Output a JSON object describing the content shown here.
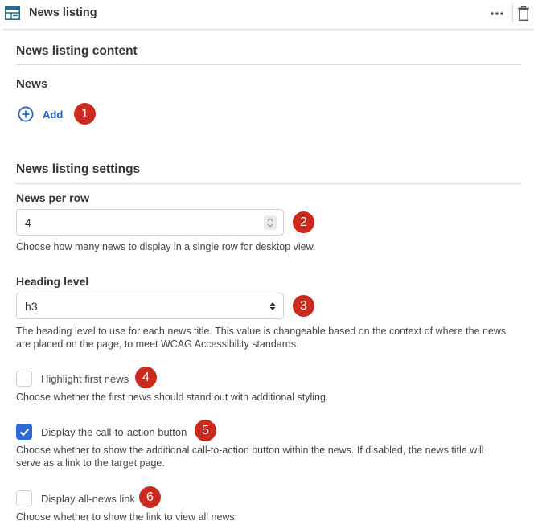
{
  "header": {
    "title": "News listing",
    "icons": {
      "block": "news-listing-block-icon",
      "more": "more-options-icon",
      "delete": "trash-icon"
    }
  },
  "content_section": {
    "title": "News listing content",
    "news_label": "News",
    "add_label": "Add",
    "add_icon": "plus-circle-icon",
    "badge": "1"
  },
  "settings_section": {
    "title": "News listing settings",
    "news_per_row": {
      "label": "News per row",
      "value": "4",
      "help": "Choose how many news to display in a single row for desktop view.",
      "badge": "2"
    },
    "heading_level": {
      "label": "Heading level",
      "value": "h3",
      "help_line1": "The heading level to use for each news title. This value is changeable based on the context of where the news",
      "help_line2": "are placed on the page, to meet WCAG Accessibility standards.",
      "badge": "3"
    },
    "highlight_first": {
      "label": "Highlight first news",
      "checked": false,
      "help": "Choose whether the first news should stand out with additional styling.",
      "badge": "4"
    },
    "display_cta": {
      "label": "Display the call-to-action button",
      "checked": true,
      "help_line1": "Choose whether to show the additional call-to-action button within the news. If disabled, the news title will",
      "help_line2": "serve as a link to the target page.",
      "badge": "5"
    },
    "display_all_news": {
      "label": "Display all-news link",
      "checked": false,
      "help": "Choose whether to show the link to view all news.",
      "badge": "6"
    }
  },
  "colors": {
    "accent": "#1f5fbf",
    "badge": "#cc2a1e",
    "checkbox_checked": "#2d6ad1",
    "icon_teal": "#2a6a8a"
  }
}
